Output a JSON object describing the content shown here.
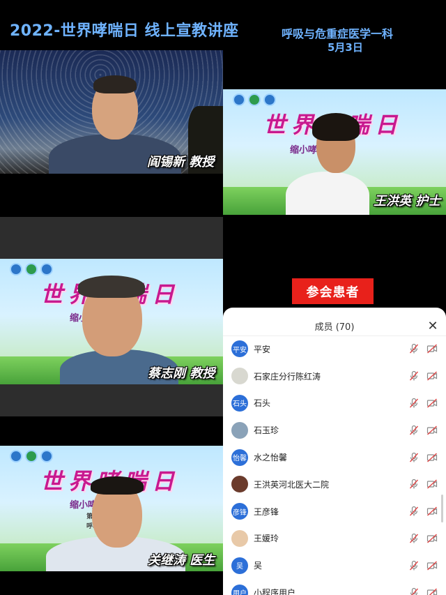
{
  "header": {
    "title": "2022-世界哮喘日 线上宣教讲座",
    "department": "呼吸与危重症医学一科",
    "date": "5月3日"
  },
  "tiles": {
    "speaker1": {
      "name": "阎锡新 教授"
    },
    "speaker2": {
      "name": "王洪英 护士",
      "banner_title": "世界哮喘日",
      "banner_sub": "缩小哮喘 差距"
    },
    "speaker3": {
      "name": "蔡志刚 教授",
      "banner_title": "世界哮喘日",
      "banner_sub": "缩小哮喘 差距"
    },
    "speaker4": {
      "name": "关继涛 医生",
      "banner_title": "世界哮喘日",
      "banner_sub": "缩小哮 差距",
      "banner_small1": "第一",
      "banner_small2": "呼吸与"
    }
  },
  "badge": {
    "label": "参会患者"
  },
  "members_panel": {
    "title": "成员 (70)",
    "close_icon": "close-icon",
    "members": [
      {
        "avatar_text": "平安",
        "avatar_type": "text",
        "name": "平安",
        "mic": "muted",
        "cam": "off"
      },
      {
        "avatar_text": "",
        "avatar_type": "image",
        "name": "石家庄分行陈红涛",
        "mic": "muted",
        "cam": "off"
      },
      {
        "avatar_text": "石头",
        "avatar_type": "text",
        "name": "石头",
        "mic": "muted",
        "cam": "off"
      },
      {
        "avatar_text": "",
        "avatar_type": "image",
        "name": "石玉珍",
        "mic": "muted",
        "cam": "off"
      },
      {
        "avatar_text": "怡馨",
        "avatar_type": "text",
        "name": "水之怡馨",
        "mic": "muted",
        "cam": "off"
      },
      {
        "avatar_text": "",
        "avatar_type": "image",
        "name": "王洪英河北医大二院",
        "mic": "muted",
        "cam": "off"
      },
      {
        "avatar_text": "彦锋",
        "avatar_type": "text",
        "name": "王彦锋",
        "mic": "muted",
        "cam": "off"
      },
      {
        "avatar_text": "",
        "avatar_type": "image",
        "name": "王媛玲",
        "mic": "muted",
        "cam": "off"
      },
      {
        "avatar_text": "吴",
        "avatar_type": "text",
        "name": "吴",
        "mic": "muted",
        "cam": "off"
      },
      {
        "avatar_text": "用户",
        "avatar_type": "text",
        "name": "小程序用户",
        "mic": "muted",
        "cam": "off"
      }
    ]
  },
  "colors": {
    "title_blue": "#6fb3ff",
    "badge_red": "#e8211b",
    "avatar_blue": "#2c6fd8",
    "muted_red": "#e04848"
  }
}
